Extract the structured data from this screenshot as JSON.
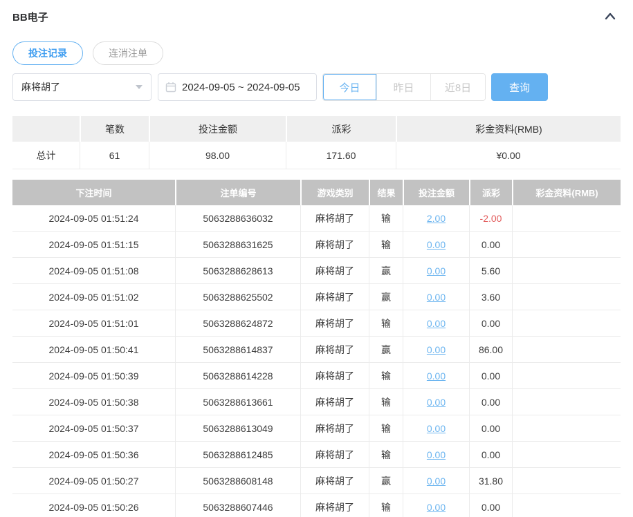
{
  "header": {
    "title": "BB电子"
  },
  "tabs": [
    {
      "label": "投注记录",
      "active": true
    },
    {
      "label": "连消注单",
      "active": false
    }
  ],
  "filters": {
    "game_select": {
      "value": "麻将胡了"
    },
    "date_range": {
      "value": "2024-09-05 ~ 2024-09-05"
    },
    "quick_buttons": [
      {
        "label": "今日",
        "active": true
      },
      {
        "label": "昨日",
        "active": false
      },
      {
        "label": "近8日",
        "active": false
      }
    ],
    "search_label": "查询"
  },
  "summary": {
    "headers": [
      "",
      "笔数",
      "投注金额",
      "派彩",
      "彩金资料(RMB)"
    ],
    "total": {
      "label": "总计",
      "count": "61",
      "bet_amount": "98.00",
      "payout": "171.60",
      "jackpot": "¥0.00"
    }
  },
  "table": {
    "headers": [
      "下注时间",
      "注单编号",
      "游戏类别",
      "结果",
      "投注金额",
      "派彩",
      "彩金资料(RMB)"
    ],
    "rows": [
      {
        "time": "2024-09-05 01:51:24",
        "order_no": "5063288636032",
        "game": "麻将胡了",
        "result": "输",
        "bet": "2.00",
        "payout": "-2.00",
        "jackpot": ""
      },
      {
        "time": "2024-09-05 01:51:15",
        "order_no": "5063288631625",
        "game": "麻将胡了",
        "result": "输",
        "bet": "0.00",
        "payout": "0.00",
        "jackpot": ""
      },
      {
        "time": "2024-09-05 01:51:08",
        "order_no": "5063288628613",
        "game": "麻将胡了",
        "result": "赢",
        "bet": "0.00",
        "payout": "5.60",
        "jackpot": ""
      },
      {
        "time": "2024-09-05 01:51:02",
        "order_no": "5063288625502",
        "game": "麻将胡了",
        "result": "赢",
        "bet": "0.00",
        "payout": "3.60",
        "jackpot": ""
      },
      {
        "time": "2024-09-05 01:51:01",
        "order_no": "5063288624872",
        "game": "麻将胡了",
        "result": "输",
        "bet": "0.00",
        "payout": "0.00",
        "jackpot": ""
      },
      {
        "time": "2024-09-05 01:50:41",
        "order_no": "5063288614837",
        "game": "麻将胡了",
        "result": "赢",
        "bet": "0.00",
        "payout": "86.00",
        "jackpot": ""
      },
      {
        "time": "2024-09-05 01:50:39",
        "order_no": "5063288614228",
        "game": "麻将胡了",
        "result": "输",
        "bet": "0.00",
        "payout": "0.00",
        "jackpot": ""
      },
      {
        "time": "2024-09-05 01:50:38",
        "order_no": "5063288613661",
        "game": "麻将胡了",
        "result": "输",
        "bet": "0.00",
        "payout": "0.00",
        "jackpot": ""
      },
      {
        "time": "2024-09-05 01:50:37",
        "order_no": "5063288613049",
        "game": "麻将胡了",
        "result": "输",
        "bet": "0.00",
        "payout": "0.00",
        "jackpot": ""
      },
      {
        "time": "2024-09-05 01:50:36",
        "order_no": "5063288612485",
        "game": "麻将胡了",
        "result": "输",
        "bet": "0.00",
        "payout": "0.00",
        "jackpot": ""
      },
      {
        "time": "2024-09-05 01:50:27",
        "order_no": "5063288608148",
        "game": "麻将胡了",
        "result": "赢",
        "bet": "0.00",
        "payout": "31.80",
        "jackpot": ""
      },
      {
        "time": "2024-09-05 01:50:26",
        "order_no": "5063288607446",
        "game": "麻将胡了",
        "result": "输",
        "bet": "0.00",
        "payout": "0.00",
        "jackpot": ""
      }
    ]
  },
  "colors": {
    "accent_blue": "#64b1f1",
    "link_blue": "#6cb5f0",
    "negative_red": "#e25b5b",
    "detail_header_bg": "#c2c2c2",
    "summary_header_bg": "#efefef"
  }
}
